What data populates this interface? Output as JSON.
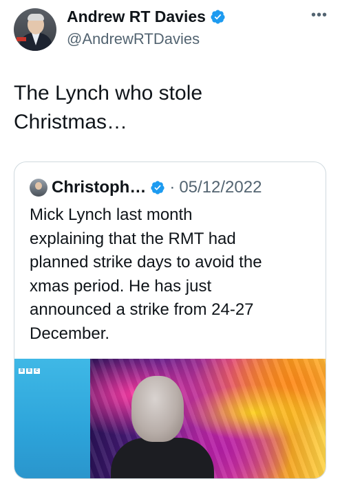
{
  "author": {
    "name": "Andrew RT Davies",
    "handle": "@AndrewRTDavies",
    "verified_color": "#1d9bf0"
  },
  "tweet": {
    "text": "The Lynch who stole\nChristmas…"
  },
  "more_icon": "more-horizontal-icon",
  "quoted_tweet": {
    "author_name": "Christoph…",
    "separator": "·",
    "date": "05/12/2022",
    "text": "Mick Lynch last month\nexplaining that the RMT had\nplanned strike days to avoid the\nxmas period. He has just\nannounced a strike from 24-27\nDecember."
  },
  "media": {
    "broadcaster_label": [
      "B",
      "B",
      "C"
    ]
  }
}
